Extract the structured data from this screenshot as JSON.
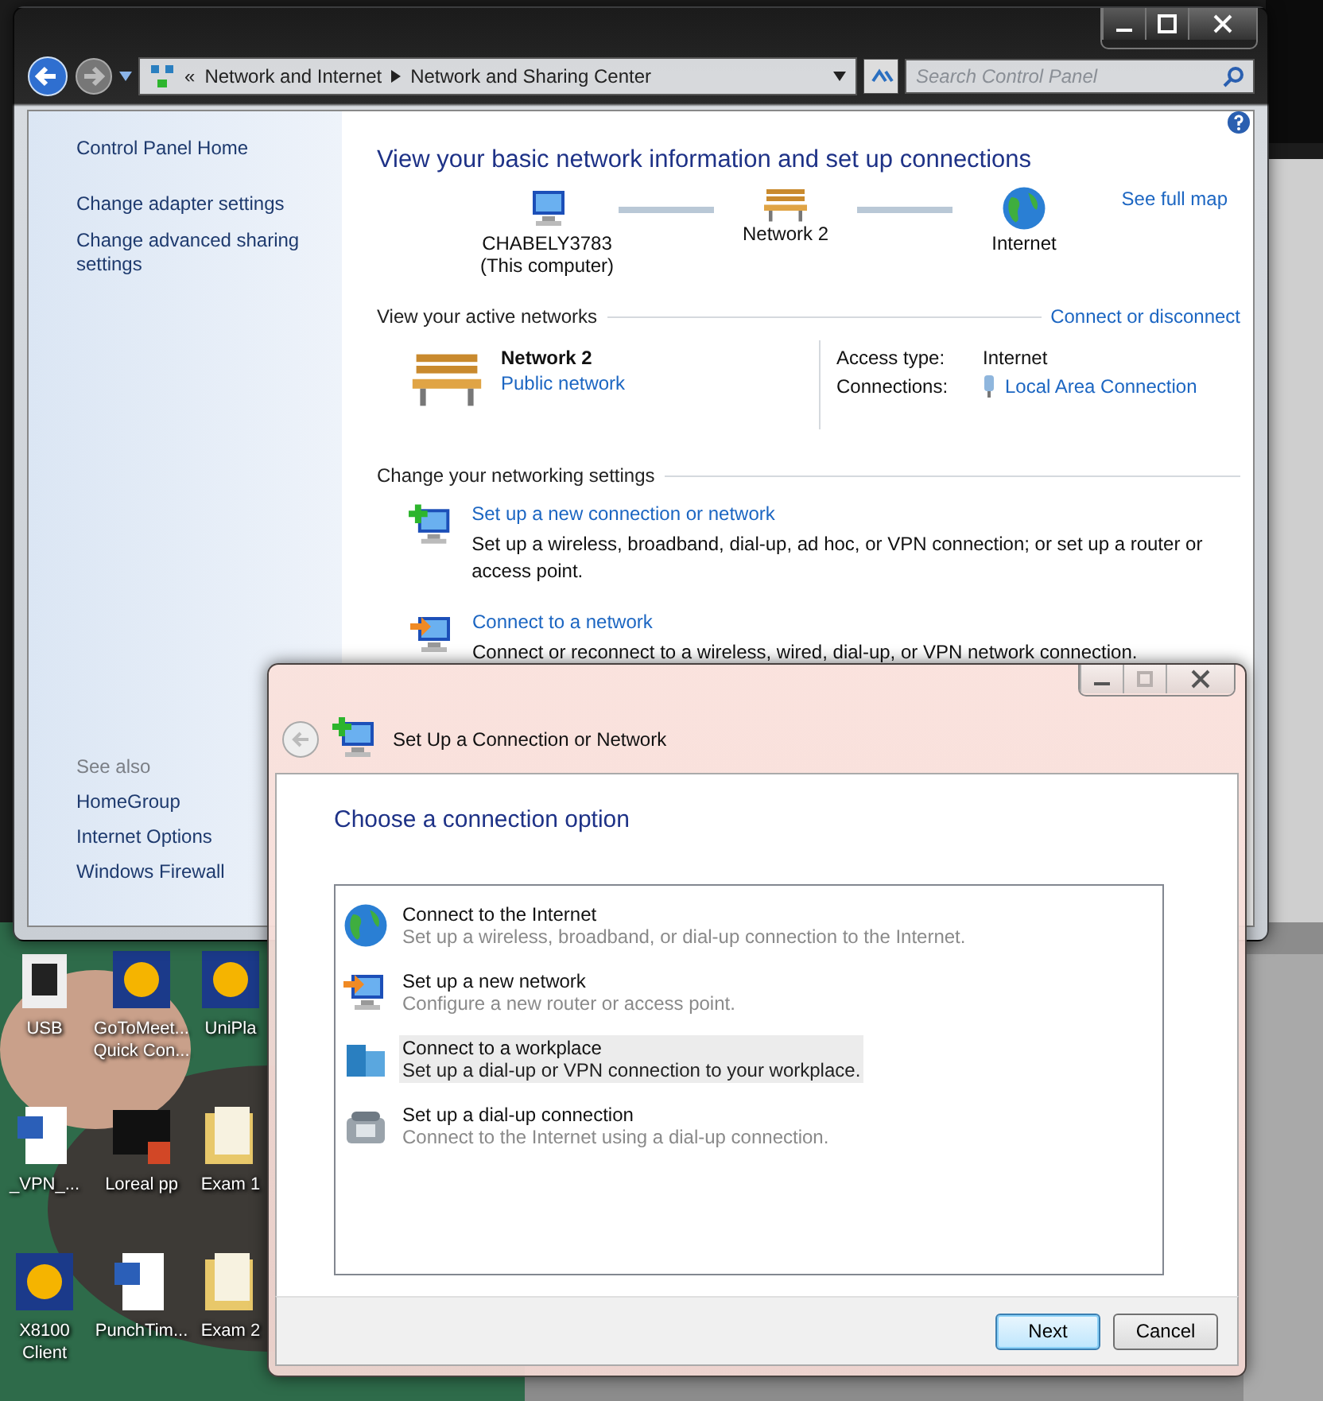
{
  "desktop": {
    "icons": [
      {
        "label": "USB",
        "kind": "drive"
      },
      {
        "label": "GoToMeet... Quick Con...",
        "kind": "app"
      },
      {
        "label": "UniPla",
        "kind": "app"
      },
      {
        "label": "_VPN_...",
        "kind": "document"
      },
      {
        "label": "Loreal pp",
        "kind": "slides"
      },
      {
        "label": "Exam 1",
        "kind": "folder"
      },
      {
        "label": "X8100 Client",
        "kind": "app"
      },
      {
        "label": "PunchTim...",
        "kind": "document"
      },
      {
        "label": "Exam 2",
        "kind": "folder"
      }
    ]
  },
  "main_window": {
    "address": {
      "overflow": "«",
      "crumbs": [
        "Network and Internet",
        "Network and Sharing Center"
      ]
    },
    "search": {
      "placeholder": "Search Control Panel"
    },
    "sidebar": {
      "items": [
        "Control Panel Home",
        "Change adapter settings",
        "Change advanced sharing settings"
      ],
      "see_also_heading": "See also",
      "see_also": [
        "HomeGroup",
        "Internet Options",
        "Windows Firewall"
      ]
    },
    "heading": "View your basic network information and set up connections",
    "see_full_map": "See full map",
    "map": [
      {
        "kind": "computer",
        "label": "CHABELY3783",
        "sublabel": "(This computer)"
      },
      {
        "kind": "network",
        "label": "Network  2"
      },
      {
        "kind": "internet",
        "label": "Internet"
      }
    ],
    "active_networks": {
      "heading": "View your active networks",
      "action": "Connect or disconnect",
      "name": "Network  2",
      "type": "Public network",
      "access_type_label": "Access type:",
      "access_type": "Internet",
      "connections_label": "Connections:",
      "connection": "Local Area Connection"
    },
    "settings": {
      "heading": "Change your networking settings",
      "items": [
        {
          "kind": "new",
          "title": "Set up a new connection or network",
          "description": "Set up a wireless, broadband, dial-up, ad hoc, or VPN connection; or set up a router or access point."
        },
        {
          "kind": "connect",
          "title": "Connect to a network",
          "description": "Connect or reconnect to a wireless, wired, dial-up, or VPN network connection."
        }
      ]
    }
  },
  "dialog": {
    "title": "Set Up a Connection or Network",
    "heading": "Choose a connection option",
    "options": [
      {
        "kind": "internet",
        "title": "Connect to the Internet",
        "description": "Set up a wireless, broadband, or dial-up connection to the Internet.",
        "selected": false
      },
      {
        "kind": "network",
        "title": "Set up a new network",
        "description": "Configure a new router or access point.",
        "selected": false
      },
      {
        "kind": "workplace",
        "title": "Connect to a workplace",
        "description": "Set up a dial-up or VPN connection to your workplace.",
        "selected": true
      },
      {
        "kind": "dialup",
        "title": "Set up a dial-up connection",
        "description": "Connect to the Internet using a dial-up connection.",
        "selected": false
      }
    ],
    "buttons": [
      {
        "label": "Next",
        "default": true
      },
      {
        "label": "Cancel",
        "default": false
      }
    ]
  }
}
